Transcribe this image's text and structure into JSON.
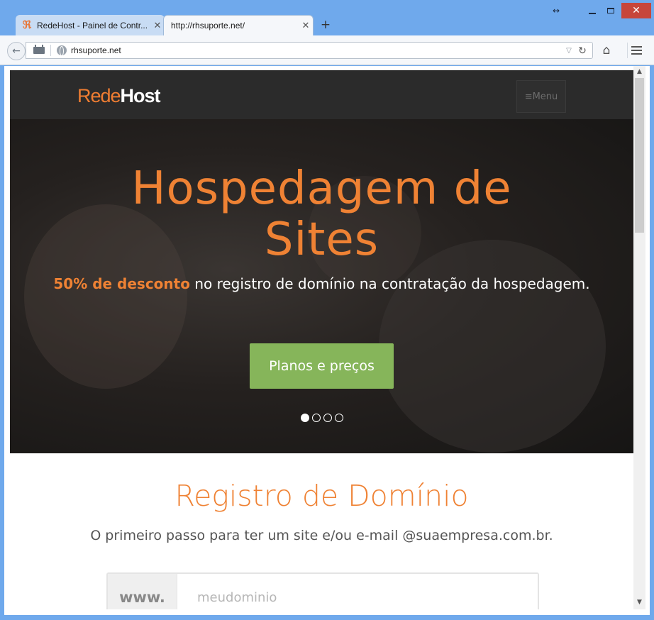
{
  "window": {
    "controls": {
      "resize": "↔",
      "minimize": "",
      "maximize": "",
      "close": "✕"
    }
  },
  "tabs": [
    {
      "title": "RedeHost - Painel de Contr...",
      "favicon": "redehost-logo-icon",
      "close": "✕"
    },
    {
      "title": "http://rhsuporte.net/",
      "close": "✕"
    }
  ],
  "newtab_label": "+",
  "navbar": {
    "url": "rhsuporte.net",
    "icons": [
      "back-arrow-icon",
      "history-icon",
      "globe-icon",
      "dropdown-icon",
      "reload-icon",
      "home-icon",
      "hamburger-icon"
    ]
  },
  "site": {
    "logo_part1": "Rede",
    "logo_part2": "Host",
    "menu_label": "≡Menu",
    "hero": {
      "title_line1": "Hospedagem de",
      "title_line2": "Sites",
      "subtitle_highlight": "50% de desconto",
      "subtitle_rest": " no registro de domínio na contratação da hospedagem.",
      "cta_label": "Planos e preços",
      "slide_count": 4,
      "active_slide": 1
    },
    "domain": {
      "title": "Registro de Domínio",
      "subtitle": "O primeiro passo para ter um site e/ou e-mail @suaempresa.com.br.",
      "prefix": "www.",
      "placeholder": "meudominio"
    }
  },
  "colors": {
    "accent": "#ef8234",
    "cta": "#86b55a",
    "header_bg": "#2b2b2b",
    "window_frame": "#6fa9ec",
    "close_button": "#c7463b"
  }
}
